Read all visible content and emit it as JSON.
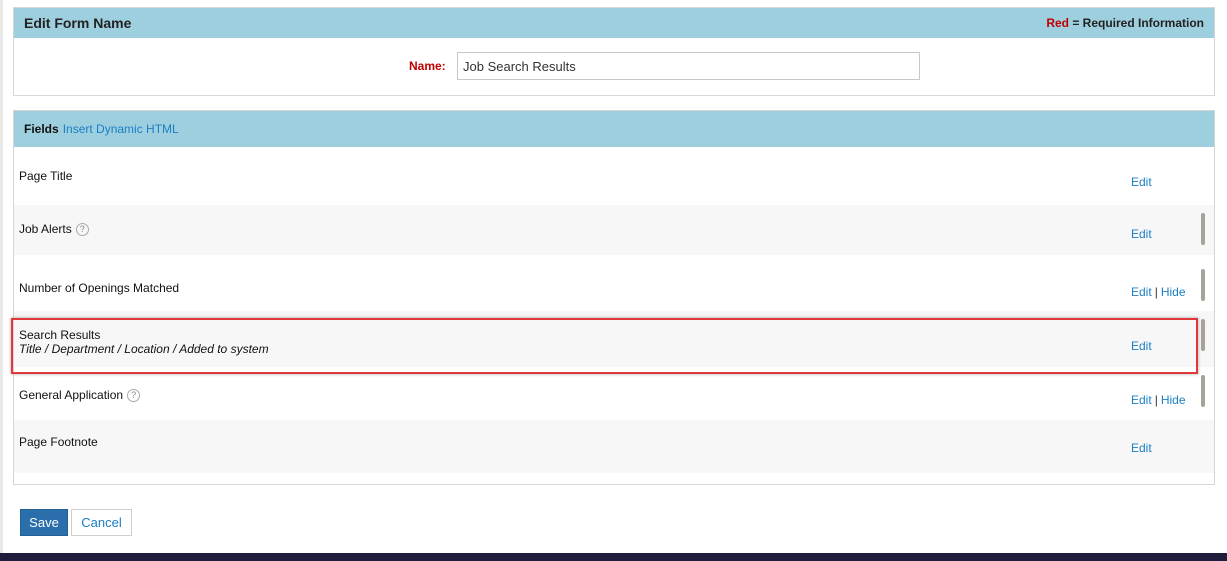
{
  "form_panel": {
    "title": "Edit Form Name",
    "required_note_red": "Red",
    "required_note_rest": " = Required Information",
    "name_label": "Name:",
    "name_value": "Job Search Results"
  },
  "fields_panel": {
    "title": "Fields",
    "insert_link": "Insert Dynamic HTML",
    "rows": [
      {
        "name": "Page Title",
        "edit": "Edit"
      },
      {
        "name": "Job Alerts",
        "help_icon": "question-circle-icon",
        "edit": "Edit"
      },
      {
        "name": "Number of Openings Matched",
        "edit": "Edit",
        "separator": "|",
        "hide": "Hide"
      },
      {
        "name": "Search Results",
        "subtitle": "Title / Department / Location / Added to system",
        "edit": "Edit"
      },
      {
        "name": "General Application",
        "help_icon": "question-circle-icon",
        "edit": "Edit",
        "separator": "|",
        "hide": "Hide"
      },
      {
        "name": "Page Footnote",
        "edit": "Edit"
      }
    ]
  },
  "buttons": {
    "save": "Save",
    "cancel": "Cancel"
  },
  "colors": {
    "header_bg": "#9ecfde",
    "required_red": "#c00000",
    "link_blue": "#1a7fc4",
    "save_bg": "#2a6eac",
    "highlight_red": "#e0393b"
  }
}
